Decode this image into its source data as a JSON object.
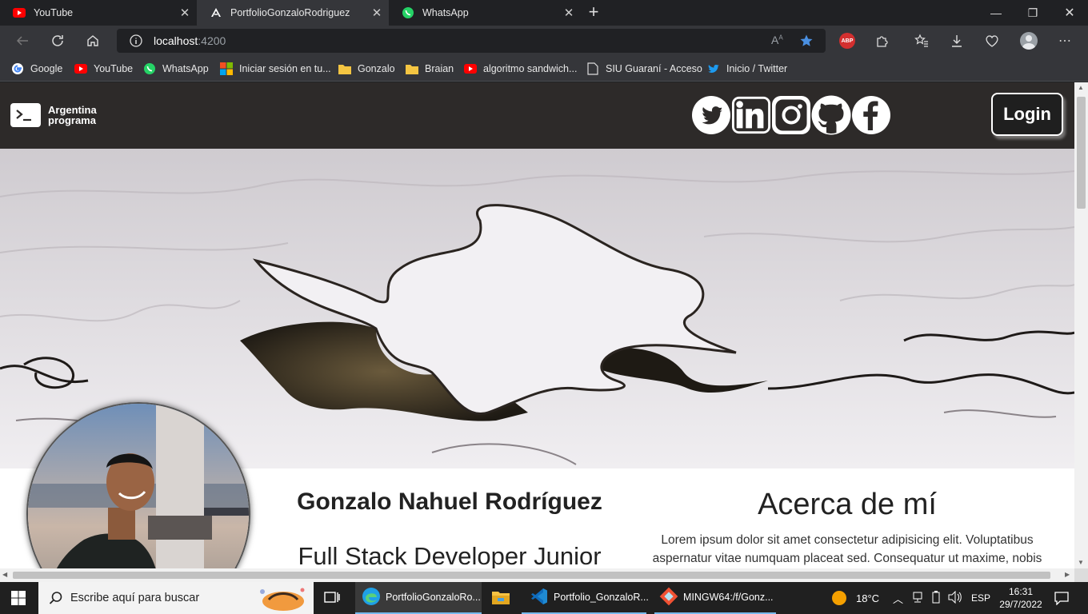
{
  "browser": {
    "tabs": [
      {
        "title": "YouTube",
        "favicon": "youtube-icon"
      },
      {
        "title": "PortfolioGonzaloRodriguez",
        "favicon": "angular-icon"
      },
      {
        "title": "WhatsApp",
        "favicon": "whatsapp-icon"
      }
    ],
    "address": {
      "host": "localhost",
      "port": ":4200"
    },
    "extensions": {
      "adblock_label": "ABP"
    },
    "bookmarks": [
      {
        "label": "Google",
        "icon": "google-icon"
      },
      {
        "label": "YouTube",
        "icon": "youtube-icon"
      },
      {
        "label": "WhatsApp",
        "icon": "whatsapp-icon"
      },
      {
        "label": "Iniciar sesión en tu...",
        "icon": "microsoft-icon"
      },
      {
        "label": "Gonzalo",
        "icon": "folder-icon"
      },
      {
        "label": "Braian",
        "icon": "folder-icon"
      },
      {
        "label": "algoritmo sandwich...",
        "icon": "youtube-icon"
      },
      {
        "label": "SIU Guaraní - Acceso",
        "icon": "page-icon"
      },
      {
        "label": "Inicio / Twitter",
        "icon": "twitter-icon"
      }
    ]
  },
  "site": {
    "logo": {
      "line1": "Argentina",
      "line2": "programa"
    },
    "social": [
      "twitter-icon",
      "linkedin-icon",
      "instagram-icon",
      "github-icon",
      "facebook-icon"
    ],
    "login_label": "Login",
    "profile": {
      "name": "Gonzalo Nahuel Rodríguez",
      "role": "Full Stack Developer Junior"
    },
    "about": {
      "title": "Acerca de mí",
      "text": "Lorem ipsum dolor sit amet consectetur adipisicing elit. Voluptatibus aspernatur vitae numquam placeat sed. Consequatur ut maxime, nobis"
    }
  },
  "taskbar": {
    "search_placeholder": "Escribe aquí para buscar",
    "apps": [
      {
        "label": "PortfolioGonzaloRo...",
        "icon": "edge-icon"
      },
      {
        "label": "",
        "icon": "file-explorer-icon"
      },
      {
        "label": "Portfolio_GonzaloR...",
        "icon": "vscode-icon"
      },
      {
        "label": "MINGW64:/f/Gonz...",
        "icon": "git-bash-icon"
      }
    ],
    "weather": "18°C",
    "language": "ESP",
    "time": "16:31",
    "date": "29/7/2022"
  },
  "colors": {
    "site_nav_bg": "#2d2a29",
    "browser_frame": "#202124",
    "toolbar": "#35363a",
    "star_accent": "#4a90e2"
  }
}
